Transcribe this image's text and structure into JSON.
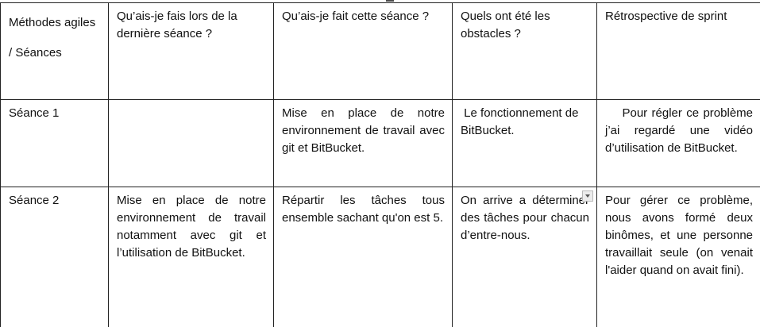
{
  "table": {
    "header": [
      "Méthodes agiles / Séances",
      "Qu’ais-je fais lors de la dernière séance ?",
      "Qu’ais-je fait cette séance ?",
      "Quels ont été les obstacles ?",
      "Rétrospective de sprint"
    ],
    "rows": [
      {
        "seance": "Séance 1",
        "derniere": "",
        "cette": "Mise en place de notre environnement de travail avec git et BitBucket.",
        "obstacles": " Le fonctionnement de BitBucket.",
        "retro": "    Pour régler ce problème j’ai regardé une vidéo d’utilisation de BitBucket."
      },
      {
        "seance": "Séance 2",
        "derniere": "Mise en place de notre environnement de travail notamment avec git et l’utilisation de BitBucket.",
        "cette": "Répartir les tâches tous ensemble sachant qu'on est 5.",
        "obstacles": "On arrive a déterminer des tâches pour chacun d’entre-nous.",
        "retro": "Pour gérer ce problème, nous avons formé deux binômes, et une personne travaillait seule (on venait l'aider quand on avait fini)."
      }
    ]
  },
  "icons": {
    "dropdown": "chevron-down-icon"
  }
}
